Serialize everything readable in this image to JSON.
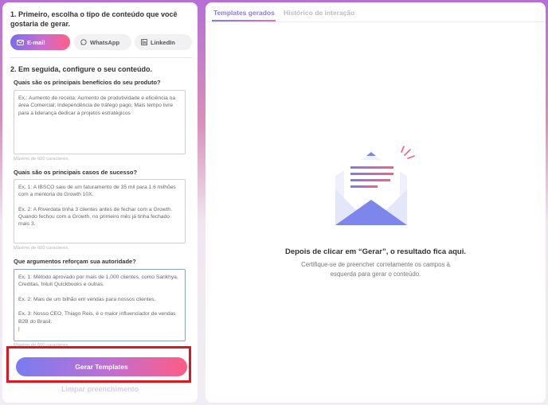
{
  "left": {
    "step1_title": "1. Primeiro, escolha o tipo de conteúdo que você gostaria de gerar.",
    "channels": [
      {
        "label": "E-mail",
        "icon": "mail-icon",
        "selected": true
      },
      {
        "label": "WhatsApp",
        "icon": "whatsapp-icon",
        "selected": false
      },
      {
        "label": "LinkedIn",
        "icon": "linkedin-icon",
        "selected": false
      }
    ],
    "step2_title": "2. Em seguida, configure o seu conteúdo.",
    "questions": [
      {
        "label": "Quais são os principais benefícios do seu produto?",
        "placeholder": "Ex.: Aumento de receita; Aumento de produtividade e eficiência na área Comercial; Independência de tráfego pago; Mais tempo livre para a liderança dedicar a projetos estratégicos",
        "hint": "Máximo de 600 caracteres."
      },
      {
        "label": "Quais são os principais casos de sucesso?",
        "placeholder": "Ex. 1: A IBSCO saiu de um faturamento de 35 mil para 1.6 milhões com a mentoria do Growth 10X.\n\nEx. 2: A Riverdata tinha 3 clientes antes de fechar com a Growth. Quando fechou com a Growth, no primeiro mês já tinha fechado mais 3.",
        "hint": "Máximo de 600 caracteres."
      },
      {
        "label": "Que argumentos reforçam sua autoridade?",
        "placeholder": "Ex. 1: Método aprovado por mais de 1.000 clientes, como Sankhya, Creditas, Intuit Quickbooks e outras.\n\nEx. 2: Mais de um bilhão em vendas para nossos clientes.\n\nEx. 3: Nosso CEO, Thiago Reis, é o maior influenciador de vendas B2B do Brasil.\n|",
        "hint": "Máximo de 600 caracteres."
      }
    ],
    "generate_label": "Gerar Templates",
    "clear_label": "Limpar preenchimento"
  },
  "right": {
    "tabs": [
      "Templates gerados",
      "Histórico de interação"
    ],
    "empty_title": "Depois de clicar em “Gerar”, o resultado fica aqui.",
    "empty_subtitle": "Certifique-se de preencher corretamente os campos à\nesquerda para gerar o conteúdo."
  },
  "colors": {
    "accent_purple": "#8d7be0",
    "accent_pink": "#ff5e8a",
    "highlight_red": "#e0161f"
  }
}
